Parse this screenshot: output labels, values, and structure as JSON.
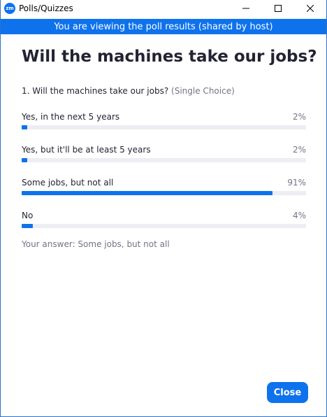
{
  "window": {
    "title": "Polls/Quizzes",
    "app_icon_text": "zm",
    "controls": [
      "minimize-icon",
      "maximize-icon",
      "close-icon"
    ]
  },
  "banner": {
    "text": "You are viewing the poll results (shared by host)",
    "color": "#0e72ed"
  },
  "poll": {
    "title": "Will the machines take our jobs?",
    "question": "1. Will the machines take our jobs?",
    "question_type": "(Single Choice)",
    "options": [
      {
        "label": "Yes, in the next 5 years",
        "percent_text": "2%",
        "percent": 2
      },
      {
        "label": "Yes, but it'll be at least 5 years",
        "percent_text": "2%",
        "percent": 2
      },
      {
        "label": "Some jobs, but not all",
        "percent_text": "91%",
        "percent": 91
      },
      {
        "label": "No",
        "percent_text": "4%",
        "percent": 4
      }
    ],
    "your_answer": "Your answer: Some jobs, but not all"
  },
  "footer": {
    "close_label": "Close"
  },
  "colors": {
    "accent": "#0e72ed",
    "track": "#ededf4"
  }
}
